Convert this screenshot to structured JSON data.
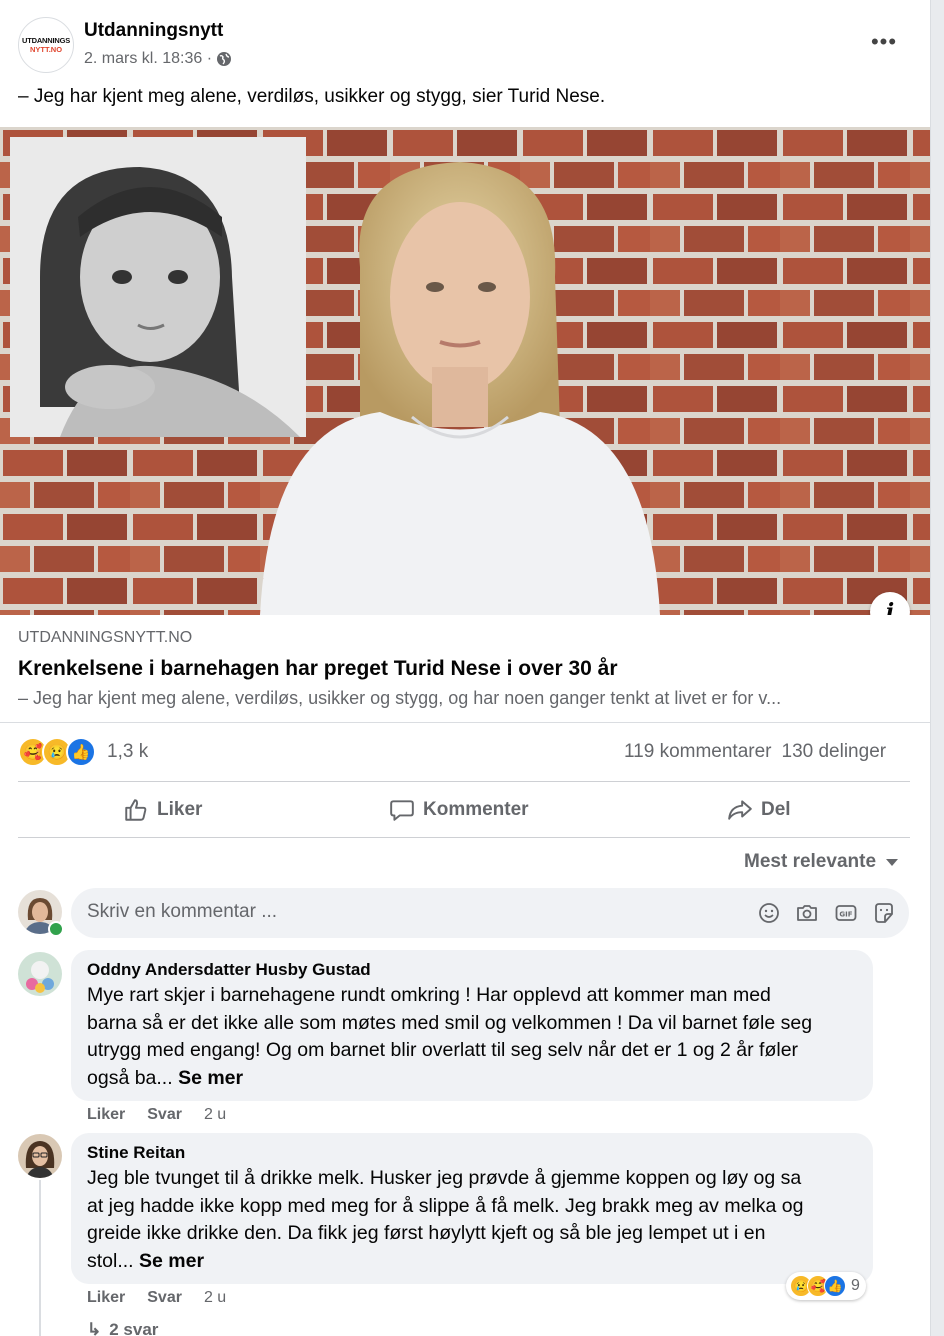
{
  "post": {
    "page_name": "Utdanningsnytt",
    "logo_line1": "UTDANNINGS",
    "logo_line2": "NYTT.NO",
    "date": "2. mars kl. 18:36 ·",
    "more_icon": "more-horizontal-icon",
    "caption": "– Jeg har kjent meg alene, verdiløs, usikker og stygg, sier Turid Nese."
  },
  "link": {
    "domain": "UTDANNINGSNYTT.NO",
    "title": "Krenkelsene i barnehagen har preget Turid Nese i over 30 år",
    "description": "– Jeg har kjent meg alene, verdiløs, usikker og stygg, og har noen ganger tenkt at livet er for v...",
    "info_label": "i"
  },
  "reactions": {
    "icons": [
      "care-icon",
      "sad-icon",
      "like-icon"
    ],
    "count": "1,3 k",
    "comments": "119 kommentarer",
    "shares": "130 delinger"
  },
  "actions": {
    "like": "Liker",
    "comment": "Kommenter",
    "share": "Del"
  },
  "sort": {
    "label": "Mest relevante"
  },
  "composer": {
    "placeholder": "Skriv en kommentar ...",
    "icons": [
      "emoji-icon",
      "camera-icon",
      "gif-icon",
      "sticker-icon"
    ]
  },
  "comments": [
    {
      "author": "Oddny Andersdatter Husby Gustad",
      "text_lines": [
        "Mye rart skjer i barnehagene rundt omkring ! Har opplevd att kommer man med",
        "barna så er det ikke alle som møtes med smil og velkommen ! Da vil barnet føle seg",
        "utrygg med engang! Og om barnet blir overlatt til seg selv når det er 1 og 2 år føler",
        "også ba..."
      ],
      "see_more": "Se mer",
      "like": "Liker",
      "reply": "Svar",
      "time": "2 u"
    },
    {
      "author": "Stine Reitan",
      "text_lines": [
        "Jeg ble tvunget til å drikke melk. Husker jeg prøvde å gjemme koppen og løy og sa",
        "at jeg hadde ikke kopp med meg for å slippe å få melk. Jeg brakk meg av melka og",
        "greide ikke drikke den. Da fikk jeg først høylytt kjeft og så ble jeg lempet ut i en",
        "stol..."
      ],
      "see_more": "Se mer",
      "like": "Liker",
      "reply": "Svar",
      "time": "2 u",
      "reaction_count": "9",
      "reaction_icons": [
        "sad-icon",
        "care-icon",
        "like-icon"
      ],
      "replies": "2 svar"
    }
  ]
}
